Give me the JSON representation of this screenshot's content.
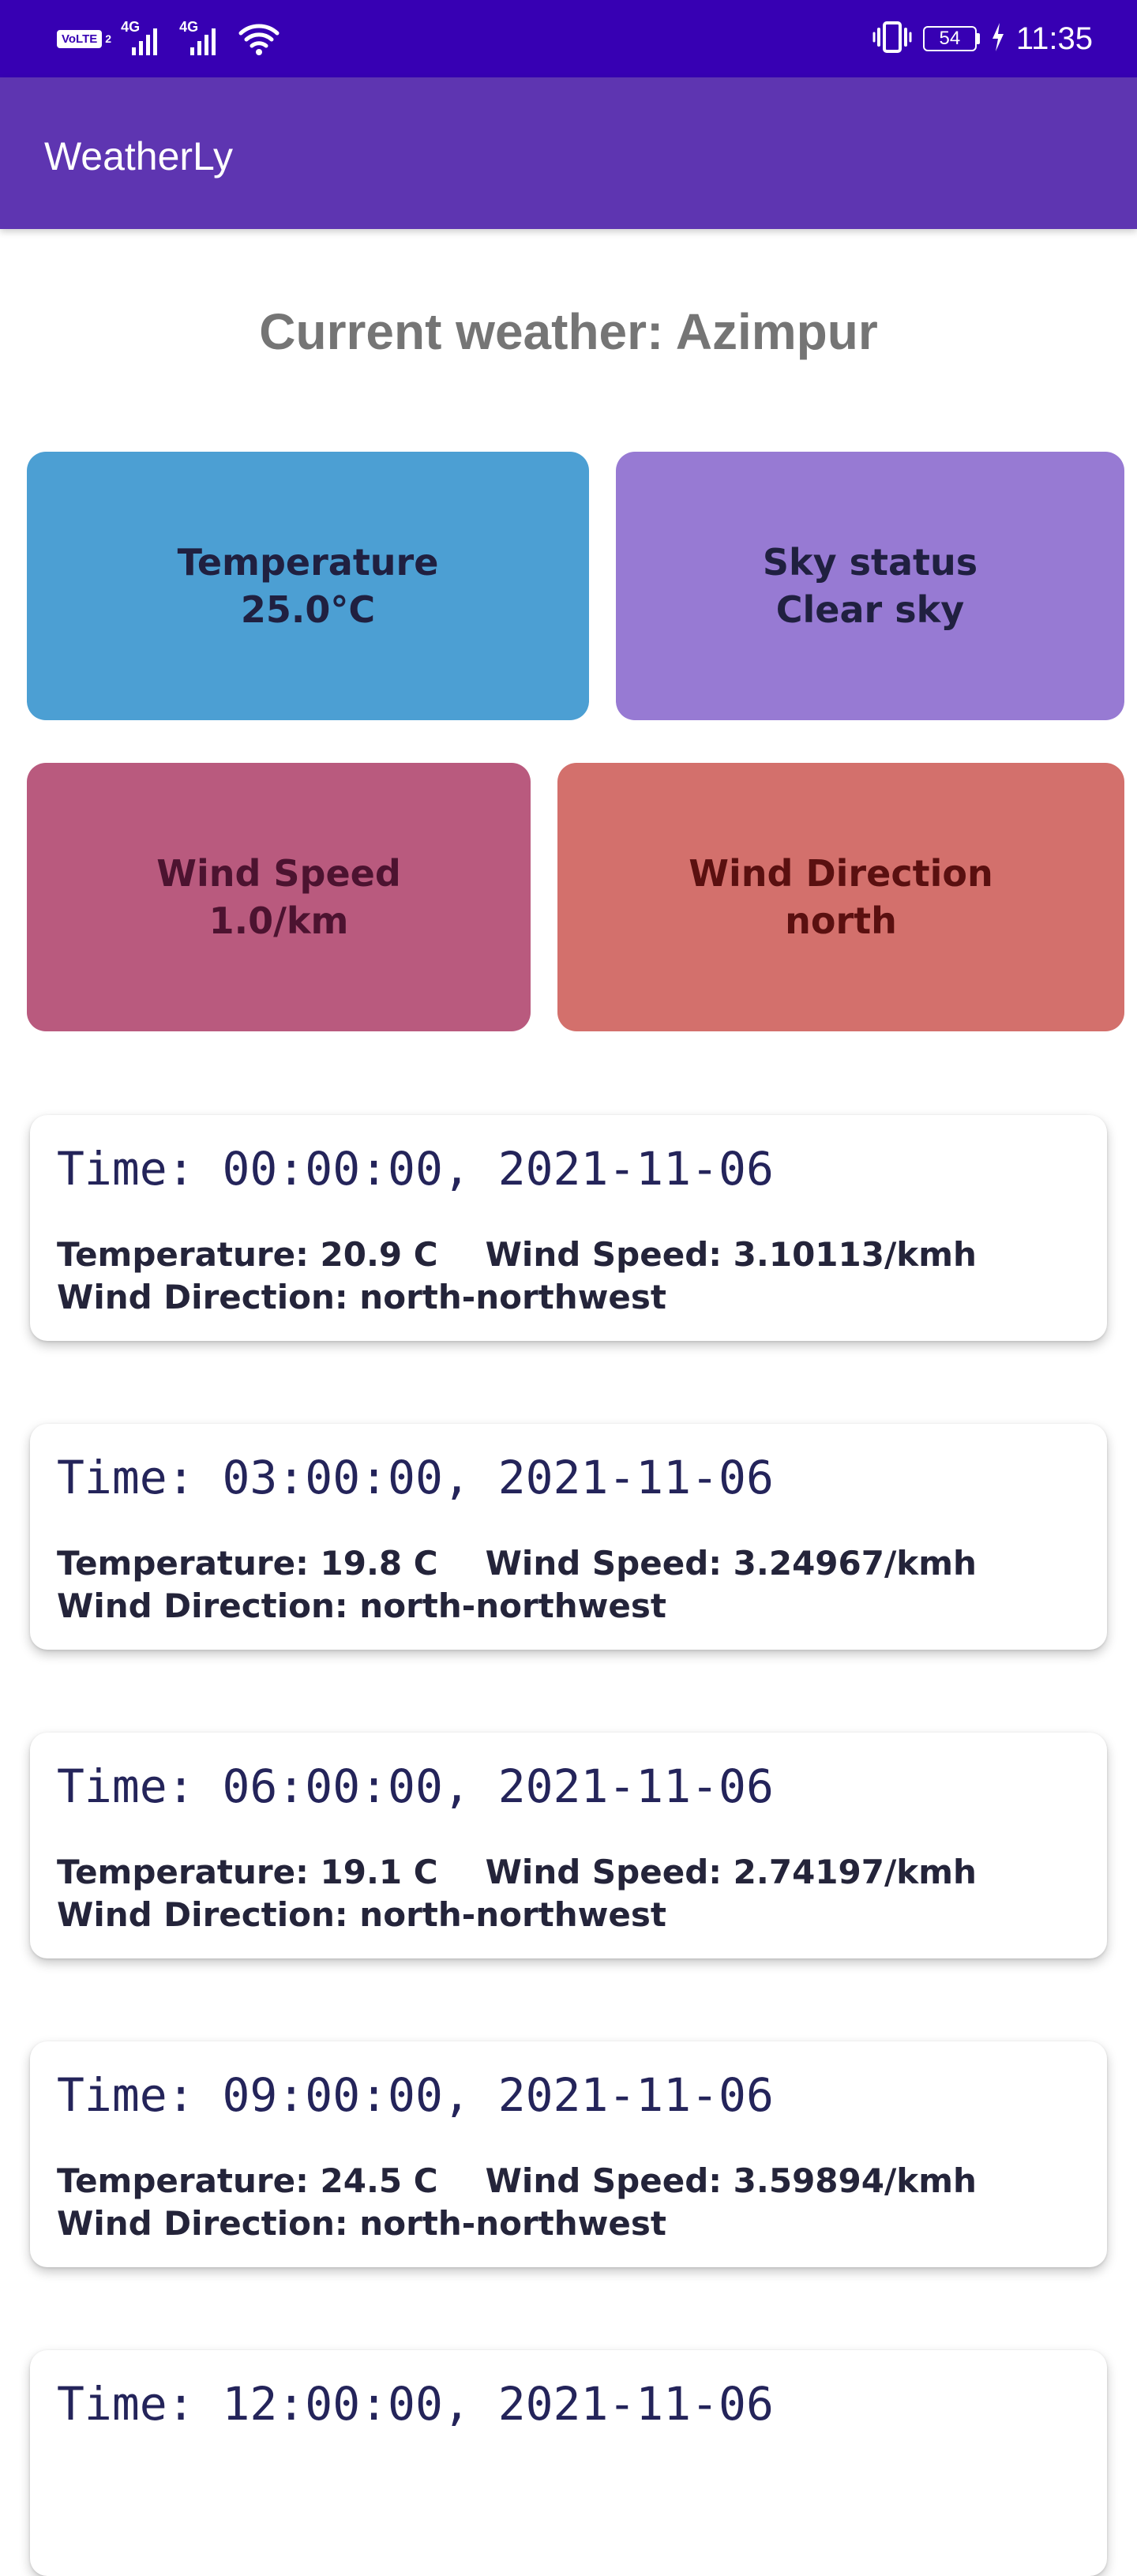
{
  "status_bar": {
    "volte_label": "VoLTE",
    "sim_number": "2",
    "network_1": "4G",
    "network_2": "4G",
    "battery_level": "54",
    "time": "11:35"
  },
  "app_bar": {
    "title": "WeatherLy"
  },
  "current": {
    "title": "Current weather: Azimpur",
    "temperature_label": "Temperature",
    "temperature_value": "25.0°C",
    "sky_label": "Sky status",
    "sky_value": "Clear sky",
    "wind_speed_label": "Wind Speed",
    "wind_speed_value": "1.0/km",
    "wind_direction_label": "Wind Direction",
    "wind_direction_value": "north"
  },
  "forecast": [
    {
      "time": "Time: 00:00:00, 2021-11-06",
      "temperature": "Temperature: 20.9 C",
      "wind_speed": "Wind Speed: 3.10113/kmh",
      "wind_direction": "Wind Direction: north-northwest"
    },
    {
      "time": "Time: 03:00:00, 2021-11-06",
      "temperature": "Temperature: 19.8 C",
      "wind_speed": "Wind Speed: 3.24967/kmh",
      "wind_direction": "Wind Direction: north-northwest"
    },
    {
      "time": "Time: 06:00:00, 2021-11-06",
      "temperature": "Temperature: 19.1 C",
      "wind_speed": "Wind Speed: 2.74197/kmh",
      "wind_direction": "Wind Direction: north-northwest"
    },
    {
      "time": "Time: 09:00:00, 2021-11-06",
      "temperature": "Temperature: 24.5 C",
      "wind_speed": "Wind Speed: 3.59894/kmh",
      "wind_direction": "Wind Direction: north-northwest"
    },
    {
      "time": "Time: 12:00:00, 2021-11-06"
    }
  ],
  "colors": {
    "status_bar": "#3700b3",
    "app_bar": "#5e35b1",
    "temperature_tile": "#4c9fd3",
    "sky_tile": "#977ad3",
    "wind_speed_tile": "#b95a7e",
    "wind_direction_tile": "#d3706c"
  }
}
